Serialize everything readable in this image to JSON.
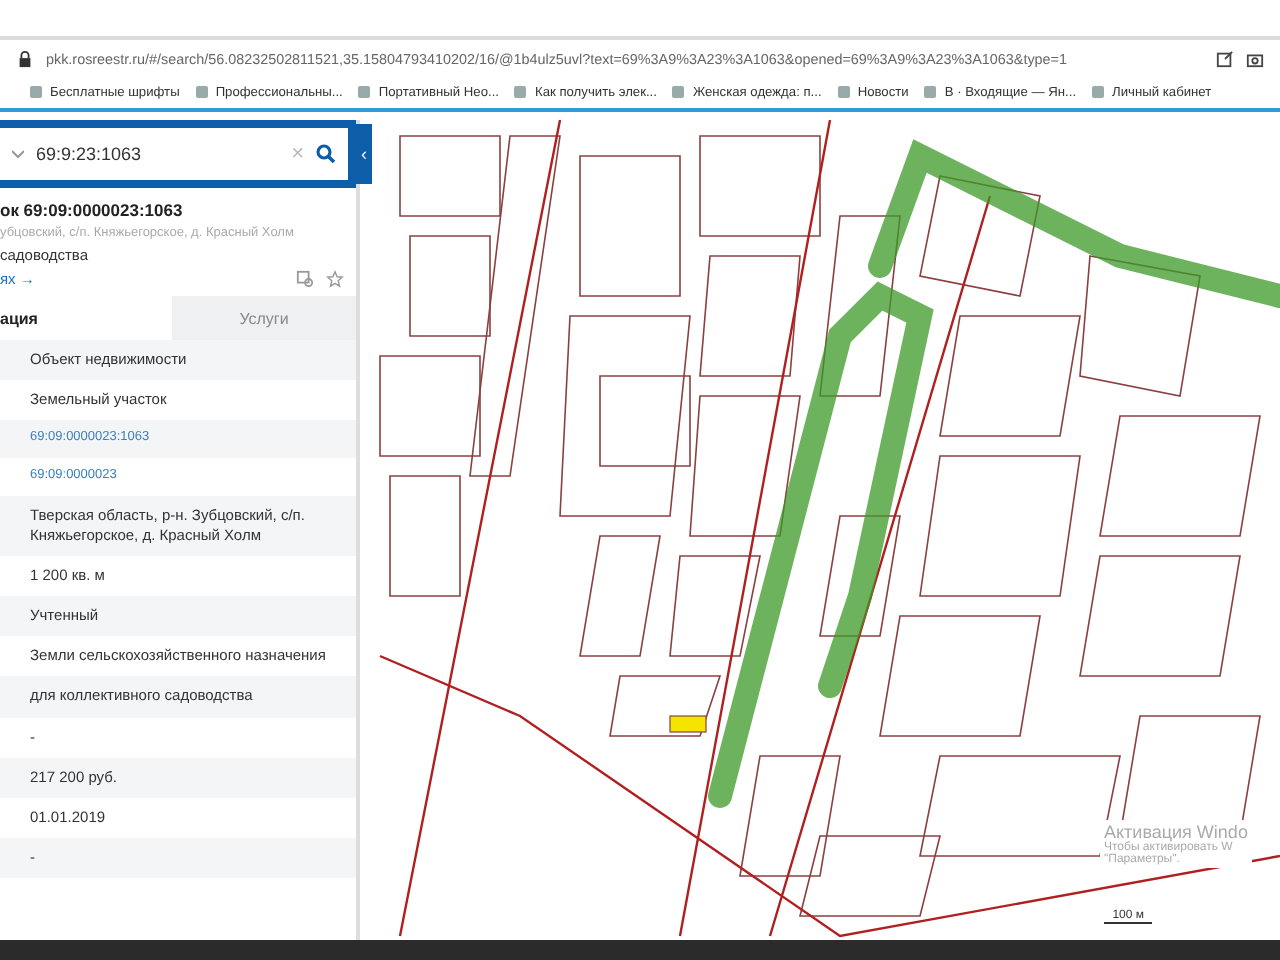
{
  "address_bar": {
    "url": "pkk.rosreestr.ru/#/search/56.08232502811521,35.15804793410202/16/@1b4ulz5uvl?text=69%3A9%3A23%3A1063&opened=69%3A9%3A23%3A1063&type=1"
  },
  "bookmarks": [
    {
      "label": "Бесплатные шрифты"
    },
    {
      "label": "Профессиональны..."
    },
    {
      "label": "Портативный Нео..."
    },
    {
      "label": "Как получить элек..."
    },
    {
      "label": "Женская одежда: п..."
    },
    {
      "label": "Новости"
    },
    {
      "label": "В · Входящие — Ян..."
    },
    {
      "label": "Личный кабинет"
    }
  ],
  "search": {
    "value": "69:9:23:1063",
    "clear": "×",
    "collapse": "‹"
  },
  "object": {
    "title": "ок 69:09:0000023:1063",
    "address": "убцовский, с/п. Княжьегорское, д. Красный Холм",
    "purpose": "садоводства",
    "link": "ях →"
  },
  "tabs": [
    {
      "label": "ация",
      "selected": true
    },
    {
      "label": "Услуги",
      "selected": false
    }
  ],
  "rows": [
    {
      "value": "Объект недвижимости",
      "kind": "text"
    },
    {
      "value": "Земельный участок",
      "kind": "text"
    },
    {
      "value": "69:09:0000023:1063",
      "kind": "link"
    },
    {
      "value": "69:09:0000023",
      "kind": "link"
    },
    {
      "value": "Тверская область, р-н. Зубцовский, с/п. Княжьегорское, д. Красный Холм",
      "kind": "text"
    },
    {
      "value": "1 200 кв. м",
      "kind": "text"
    },
    {
      "value": "Учтенный",
      "kind": "text"
    },
    {
      "value": "Земли сельскохозяйственного назначения",
      "kind": "text"
    },
    {
      "value": "для коллективного садоводства",
      "kind": "text"
    },
    {
      "value": "-",
      "kind": "text"
    },
    {
      "value": "217 200 руб.",
      "kind": "text"
    },
    {
      "value": "01.01.2019",
      "kind": "text"
    },
    {
      "value": "-",
      "kind": "text"
    }
  ],
  "map": {
    "scale": "100 м"
  },
  "activation": {
    "title": "Активация Windo",
    "line_1": "Чтобы активировать W",
    "line_2": "\"Параметры\"."
  }
}
